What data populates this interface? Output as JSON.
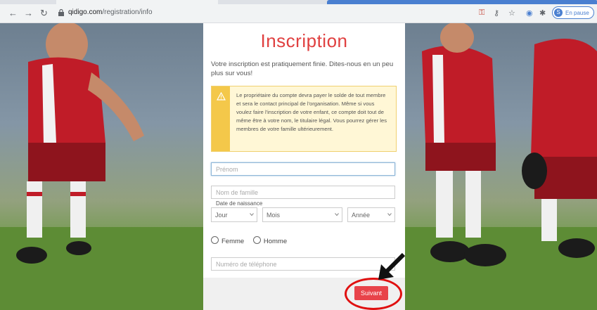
{
  "browser": {
    "url_domain": "qidigo.com",
    "url_path": "/registration/info",
    "profile_initial": "S",
    "profile_status": "En pause"
  },
  "form": {
    "title": "Inscription",
    "intro": "Votre inscription est pratiquement finie. Dites-nous en un peu plus sur vous!",
    "warning": "Le propriétaire du compte devra payer le solde de tout membre et sera le contact principal de l'organisation. Même si vous voulez faire l'inscription de votre enfant, ce compte doit tout de même être à votre nom, le titulaire légal. Vous pourrez gérer les membres de votre famille ultérieurement.",
    "first_name_placeholder": "Prénom",
    "last_name_placeholder": "Nom de famille",
    "dob_label": "Date de naissance",
    "day_label": "Jour",
    "month_label": "Mois",
    "year_label": "Année",
    "gender_female": "Femme",
    "gender_male": "Homme",
    "phone_placeholder": "Numéro de téléphone",
    "next_button": "Suivant"
  },
  "colors": {
    "accent": "#e8434a",
    "annotation": "#e01010",
    "warning_stripe": "#f4c84a"
  }
}
